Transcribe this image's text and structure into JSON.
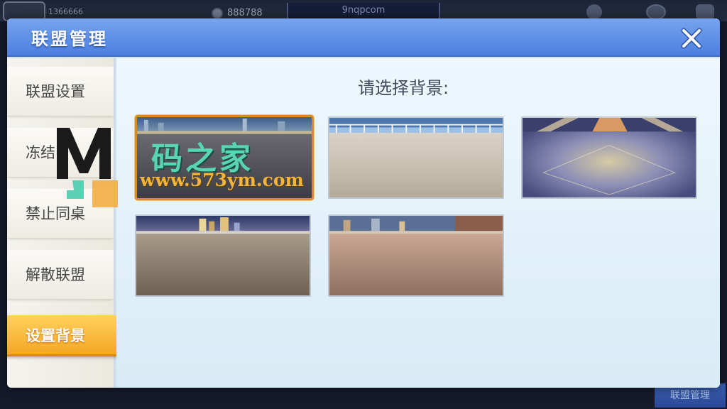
{
  "lobby": {
    "player_id": "1366666",
    "coins": "888788",
    "room_banner": "9nqpcom",
    "bottom_button": "联盟管理"
  },
  "dialog": {
    "title": "联盟管理",
    "close_icon": "close-icon"
  },
  "sidebar": {
    "items": [
      {
        "label": "联盟设置",
        "active": false
      },
      {
        "label": "冻结",
        "active": false
      },
      {
        "label": "禁止同桌",
        "active": false
      },
      {
        "label": "解散联盟",
        "active": false
      },
      {
        "label": "设置背景",
        "active": true
      }
    ]
  },
  "content": {
    "prompt": "请选择背景:",
    "backgrounds": [
      {
        "id": 1,
        "theme": "plaza-night",
        "selected": true
      },
      {
        "id": 2,
        "theme": "marble-balcony",
        "selected": false
      },
      {
        "id": 3,
        "theme": "arena-blue",
        "selected": false
      },
      {
        "id": 4,
        "theme": "city-night-wood",
        "selected": false
      },
      {
        "id": 5,
        "theme": "city-dusk-tile",
        "selected": false
      }
    ]
  },
  "watermark": {
    "logo_letters": "MJ",
    "title": "码之家",
    "url": "www.573ym.com"
  },
  "colors": {
    "header": "#5a8be6",
    "active_tab": "#f6ac2c",
    "selected_border": "#d98a2b",
    "title_text": "#ffffff"
  }
}
